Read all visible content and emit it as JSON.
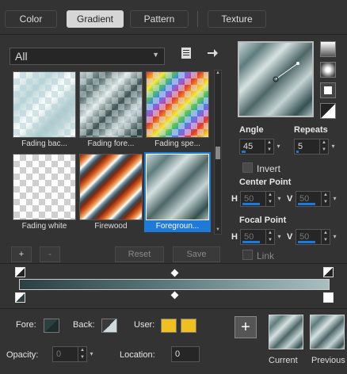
{
  "tabs": [
    {
      "label": "Color"
    },
    {
      "label": "Gradient"
    },
    {
      "label": "Pattern"
    },
    {
      "label": "Texture"
    }
  ],
  "category": {
    "selected": "All"
  },
  "gradients": [
    {
      "label": "Fading bac..."
    },
    {
      "label": "Fading fore..."
    },
    {
      "label": "Fading spe..."
    },
    {
      "label": "Fading white"
    },
    {
      "label": "Firewood"
    },
    {
      "label": "Foregroun..."
    }
  ],
  "list_buttons": {
    "add": "+",
    "remove": "-",
    "reset": "Reset",
    "save": "Save"
  },
  "settings": {
    "angle_label": "Angle",
    "angle_value": "45",
    "repeats_label": "Repeats",
    "repeats_value": "5",
    "invert_label": "Invert",
    "center_point_label": "Center Point",
    "center_h_label": "H",
    "center_h_value": "50",
    "center_v_label": "V",
    "center_v_value": "50",
    "focal_point_label": "Focal Point",
    "focal_h_label": "H",
    "focal_h_value": "50",
    "focal_v_label": "V",
    "focal_v_value": "50",
    "link_label": "Link"
  },
  "stop": {
    "fore_label": "Fore:",
    "back_label": "Back:",
    "user_label": "User:",
    "user_color": "#f0c020",
    "opacity_label": "Opacity:",
    "opacity_value": "0",
    "location_label": "Location:",
    "location_value": "0"
  },
  "recent": {
    "add": "+",
    "current_label": "Current",
    "previous_label": "Previous"
  },
  "colors": {
    "accent": "#1f79d6",
    "panel": "#333333",
    "field": "#262626"
  }
}
